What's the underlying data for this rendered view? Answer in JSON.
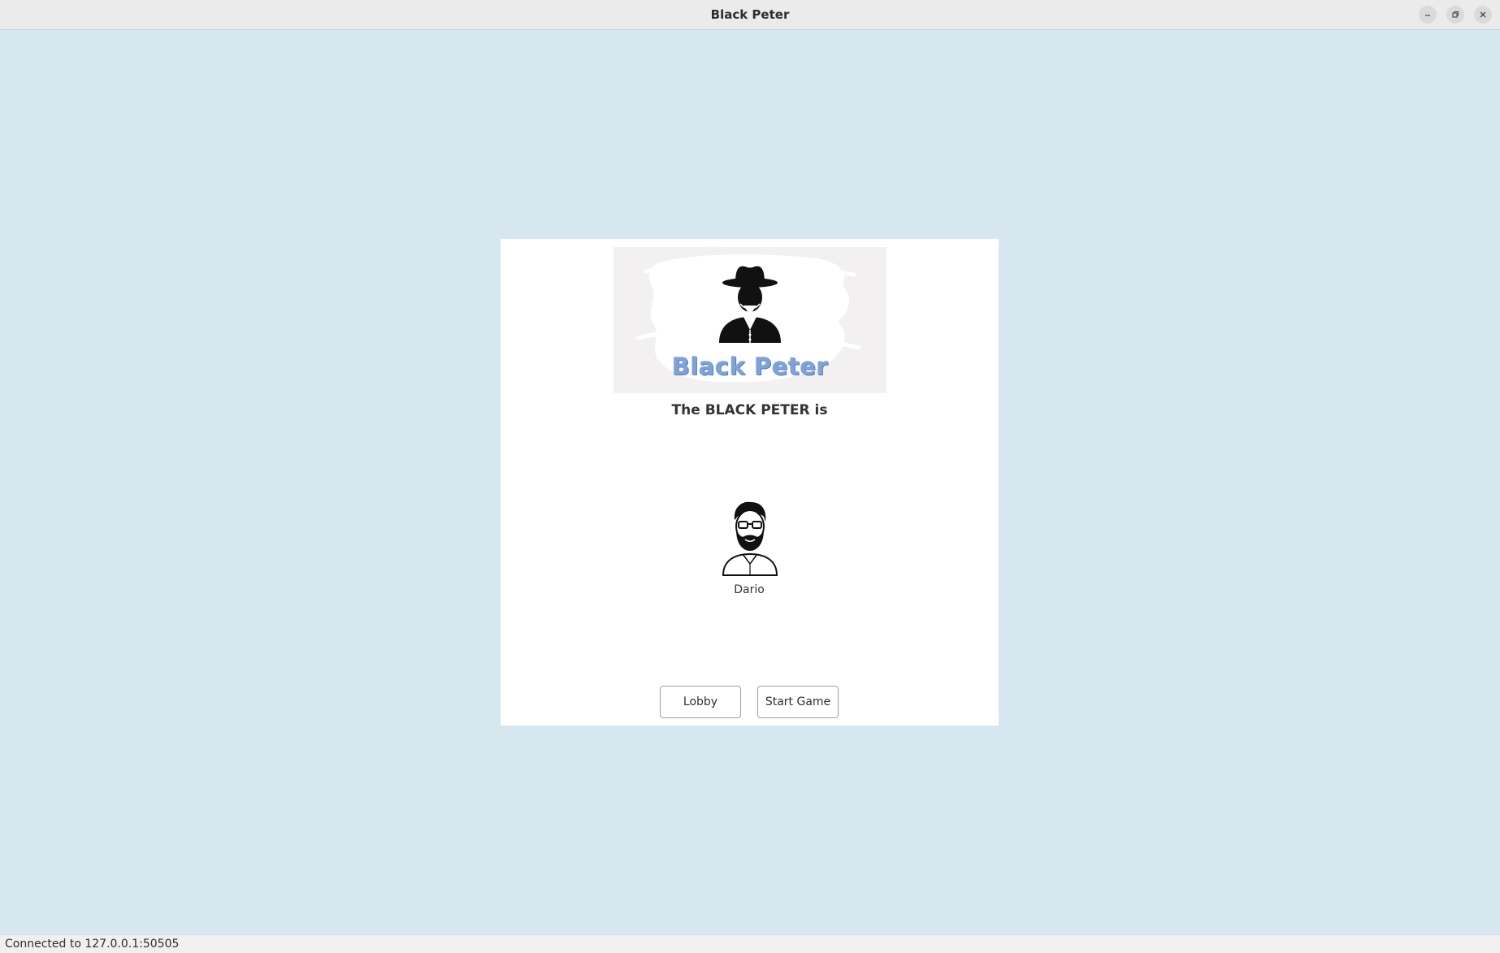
{
  "window": {
    "title": "Black Peter",
    "controls": [
      "minimize-icon",
      "restore-icon",
      "close-icon"
    ]
  },
  "logo": {
    "text": "Black Peter",
    "icon": "cowboy-icon"
  },
  "main": {
    "headline": "The BLACK PETER is",
    "player": {
      "name": "Dario",
      "icon": "bearded-man-avatar-icon"
    }
  },
  "buttons": {
    "lobby": "Lobby",
    "start_game": "Start Game"
  },
  "status": {
    "text": "Connected to 127.0.0.1:50505"
  },
  "colors": {
    "background": "#d6e7ef",
    "panel": "#ffffff",
    "logo_text": "#7ea3d8"
  }
}
